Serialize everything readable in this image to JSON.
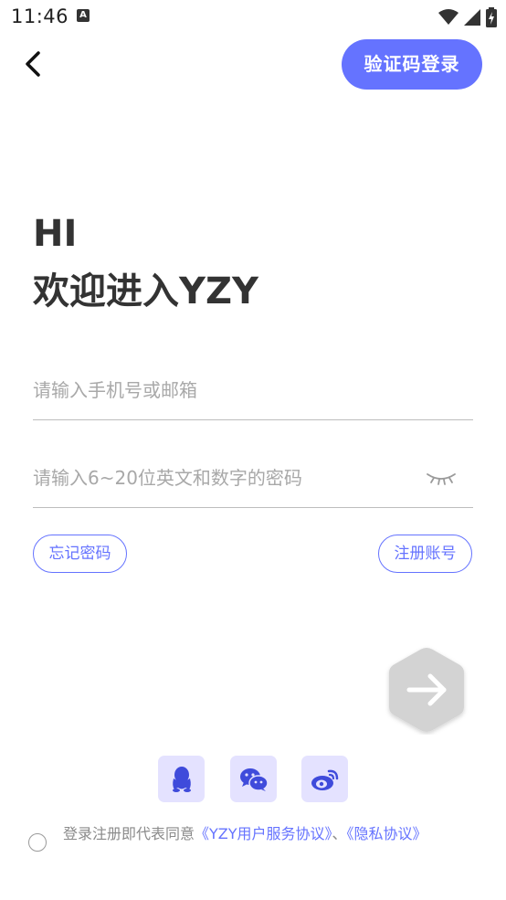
{
  "status_bar": {
    "time": "11:46",
    "notification_glyph": "A"
  },
  "header": {
    "back_icon": "chevron-left-icon",
    "code_login_label": "验证码登录"
  },
  "welcome": {
    "greeting": "HI",
    "title": "欢迎进入YZY"
  },
  "form": {
    "phone_placeholder": "请输入手机号或邮箱",
    "phone_value": "",
    "password_placeholder": "请输入6~20位英文和数字的密码",
    "password_value": "",
    "password_toggle_icon": "eye-closed-icon"
  },
  "links": {
    "forgot_password": "忘记密码",
    "register": "注册账号"
  },
  "submit": {
    "icon": "arrow-right-icon"
  },
  "social": [
    {
      "icon": "qq-icon"
    },
    {
      "icon": "wechat-icon"
    },
    {
      "icon": "weibo-icon"
    }
  ],
  "agreement": {
    "prefix": "登录注册即代表同意",
    "user_agreement": "《YZY用户服务协议》",
    "separator": "、",
    "privacy_policy": "《隐私协议》",
    "checked": false
  },
  "colors": {
    "accent": "#6573ff",
    "social_bg": "#e4e2ff",
    "submit_disabled": "#d3d3d3"
  }
}
